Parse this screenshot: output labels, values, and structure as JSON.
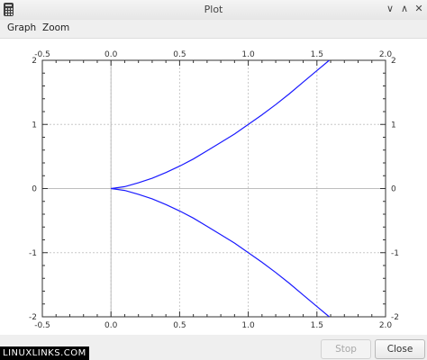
{
  "window": {
    "title": "Plot",
    "controls": {
      "minimize": "∨",
      "maximize": "∧",
      "close": "✕"
    }
  },
  "menu": {
    "items": [
      "Graph",
      "Zoom"
    ]
  },
  "buttons": {
    "stop": "Stop",
    "close": "Close"
  },
  "watermark": "LINUXLINKS.COM",
  "chart_data": {
    "type": "line",
    "title": "",
    "xlabel": "",
    "ylabel": "",
    "xlim": [
      -0.5,
      2.0
    ],
    "ylim": [
      -2,
      2
    ],
    "x_ticks": [
      "-0.5",
      "0.0",
      "0.5",
      "1.0",
      "1.5",
      "2.0"
    ],
    "y_ticks": [
      "2",
      "1",
      "0",
      "-1",
      "-2"
    ],
    "grid": true,
    "series_color": "#1a1aff",
    "series": [
      {
        "x": [
          0,
          0.1,
          0.2,
          0.3,
          0.4,
          0.5,
          0.6,
          0.7,
          0.8,
          0.9,
          1.0,
          1.1,
          1.2,
          1.3,
          1.4,
          1.5,
          1.59
        ],
        "y": [
          0,
          0.03,
          0.09,
          0.16,
          0.25,
          0.35,
          0.46,
          0.59,
          0.72,
          0.85,
          1.0,
          1.15,
          1.31,
          1.48,
          1.66,
          1.84,
          2.0
        ]
      },
      {
        "x": [
          0,
          0.1,
          0.2,
          0.3,
          0.4,
          0.5,
          0.6,
          0.7,
          0.8,
          0.9,
          1.0,
          1.1,
          1.2,
          1.3,
          1.4,
          1.5,
          1.59
        ],
        "y": [
          0,
          -0.03,
          -0.09,
          -0.16,
          -0.25,
          -0.35,
          -0.46,
          -0.59,
          -0.72,
          -0.85,
          -1.0,
          -1.15,
          -1.31,
          -1.48,
          -1.66,
          -1.84,
          -2.0
        ]
      }
    ]
  }
}
